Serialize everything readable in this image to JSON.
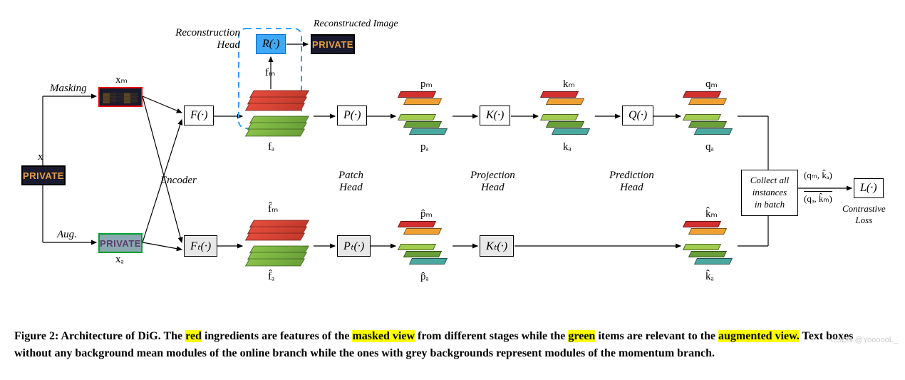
{
  "labels": {
    "x": "x",
    "xm": "xₘ",
    "xa": "xₐ",
    "masking": "Masking",
    "aug": "Aug.",
    "encoder": "Encoder",
    "fm": "fₘ",
    "fa": "fₐ",
    "fm_hat": "f̂ₘ",
    "fa_hat": "f̂ₐ",
    "recon_head": "Reconstruction\nHead",
    "recon_img": "Reconstructed Image",
    "patch_head": "Patch\nHead",
    "pm": "pₘ",
    "pa": "pₐ",
    "pm_hat": "p̂ₘ",
    "pa_hat": "p̂ₐ",
    "proj_head": "Projection\nHead",
    "km": "kₘ",
    "ka": "kₐ",
    "km_hat": "k̂ₘ",
    "ka_hat": "k̂ₐ",
    "pred_head": "Prediction\nHead",
    "qm": "qₘ",
    "qa": "qₐ",
    "loss_pairs1": "(qₘ, k̂ₐ)",
    "loss_pairs2": "(qₐ, k̂ₘ)",
    "contr_loss": "Contrastive\nLoss",
    "private": "PRIVATE"
  },
  "modules": {
    "F": "F(·)",
    "Ft": "Fₜ(·)",
    "R": "R(·)",
    "P": "P(·)",
    "Pt": "Pₜ(·)",
    "K": "K(·)",
    "Kt": "Kₜ(·)",
    "Q": "Q(·)",
    "L": "L(·)"
  },
  "collect": {
    "l1": "Collect all",
    "l2": "instances",
    "l3": "in batch"
  },
  "caption": {
    "prefix": "Figure 2: Architecture of DiG. The ",
    "red": "red",
    "mid1": " ingredients are features of the ",
    "masked_view": "masked view",
    "mid2": " from different stages while the ",
    "green": "green",
    "mid3": " items are relevant to the ",
    "aug_view": "augmented view.",
    "rest": " Text boxes without any background mean modules of the online branch while the ones with grey backgrounds represent modules of the momentum branch."
  },
  "watermark": "CSDN @YoooooL_"
}
